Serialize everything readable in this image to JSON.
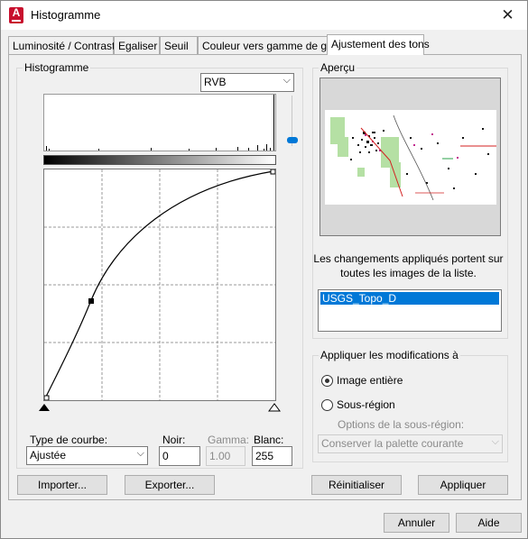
{
  "window": {
    "title": "Histogramme",
    "app_icon_letter": "A"
  },
  "tabs": [
    {
      "label": "Luminosité / Contraste"
    },
    {
      "label": "Egaliser"
    },
    {
      "label": "Seuil"
    },
    {
      "label": "Couleur vers gamme de gris"
    },
    {
      "label": "Ajustement des tons"
    }
  ],
  "active_tab": "Ajustement des tons",
  "histogram": {
    "group_label": "Histogramme",
    "channel": "RVB",
    "curve_type_label": "Type de courbe:",
    "curve_type": "Ajustée",
    "black_label": "Noir:",
    "black_value": "0",
    "gamma_label": "Gamma:",
    "gamma_value": "1.00",
    "white_label": "Blanc:",
    "white_value": "255"
  },
  "preview": {
    "group_label": "Aperçu",
    "info_text": "Les changements appliqués portent sur toutes les images de la liste.",
    "image_list": [
      "USGS_Topo_D"
    ]
  },
  "apply_to": {
    "group_label": "Appliquer les modifications à",
    "option_whole": "Image entière",
    "option_region": "Sous-région",
    "region_options_label": "Options de la sous-région:",
    "region_option_value": "Conserver la palette courante",
    "selected": "Image entière"
  },
  "buttons": {
    "import": "Importer...",
    "export": "Exporter...",
    "reset": "Réinitialiser",
    "apply": "Appliquer",
    "cancel": "Annuler",
    "help": "Aide"
  },
  "colors": {
    "accent": "#0078d7",
    "app_icon": "#c8102e"
  }
}
